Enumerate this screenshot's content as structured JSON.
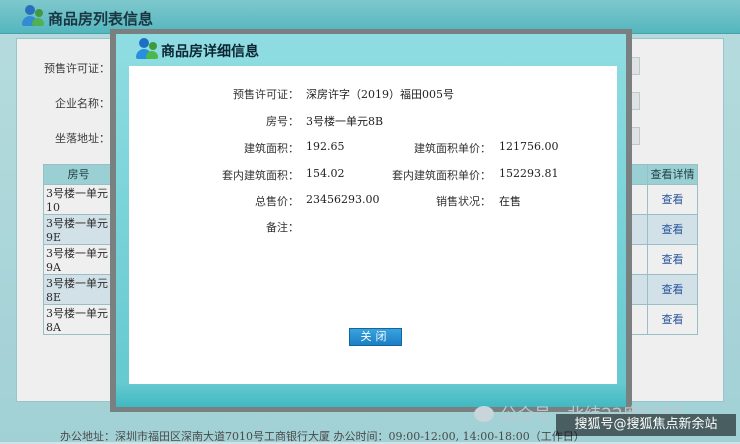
{
  "background": {
    "title": "商品房列表信息",
    "labels": {
      "permit": "预售许可证：",
      "company": "企业名称：",
      "address": "坐落地址："
    },
    "table": {
      "headers": {
        "room": "房号",
        "details": "查看详情"
      },
      "rows": [
        {
          "room": "3号楼一单元10",
          "link": "查看"
        },
        {
          "room": "3号楼一单元9E",
          "link": "查看"
        },
        {
          "room": "3号楼一单元9A",
          "link": "查看"
        },
        {
          "room": "3号楼一单元8E",
          "link": "查看"
        },
        {
          "room": "3号楼一单元8A",
          "link": "查看"
        }
      ]
    },
    "footer": "办公地址：深圳市福田区深南大道7010号工商银行大厦 办公时间：09:00-12:00, 14:00-18:00（工作日）"
  },
  "modal": {
    "title": "商品房详细信息",
    "fields": {
      "permit_label": "预售许可证：",
      "permit_value": "深房许字（2019）福田005号",
      "room_label": "房号：",
      "room_value": "3号楼一单元8B",
      "area_label": "建筑面积：",
      "area_value": "192.65",
      "price_per_area_label": "建筑面积单价：",
      "price_per_area_value": "121756.00",
      "inner_area_label": "套内建筑面积：",
      "inner_area_value": "154.02",
      "inner_price_label": "套内建筑面积单价：",
      "inner_price_value": "152293.81",
      "total_label": "总售价：",
      "total_value": "23456293.00",
      "status_label": "销售状况：",
      "status_value": "在售",
      "remark_label": "备注："
    },
    "close_label": "关闭"
  },
  "watermark": "公众号 · 北纬22度0755",
  "source_tag": "搜狐号@搜狐焦点新余站",
  "colors": {
    "header": "#4fbfc7",
    "modal_frame": "#7a7f7f",
    "button": "#1b7fc4",
    "link": "#1d4f9e"
  },
  "icons": {
    "title_icon": "users-icon"
  }
}
